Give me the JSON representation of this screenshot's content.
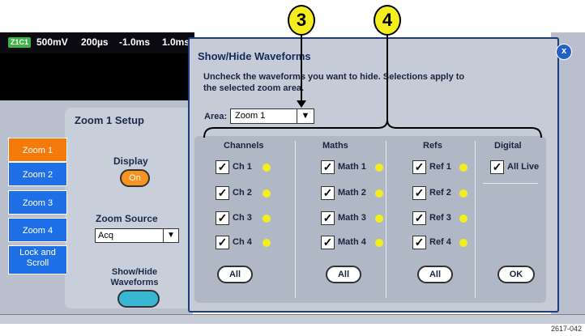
{
  "topbar": {
    "channel_badge": "Z1C1",
    "volts": "500mV",
    "time": "200µs",
    "offset": "-1.0ms",
    "position": "1.0ms"
  },
  "zoom_setup": {
    "title": "Zoom 1 Setup",
    "tabs": [
      {
        "label": "Zoom 1",
        "active": true
      },
      {
        "label": "Zoom 2",
        "active": false
      },
      {
        "label": "Zoom 3",
        "active": false
      },
      {
        "label": "Zoom 4",
        "active": false
      },
      {
        "label_line1": "Lock and",
        "label_line2": "Scroll",
        "active": false
      }
    ],
    "display_label": "Display",
    "display_value": "On",
    "zoom_source_label": "Zoom Source",
    "zoom_source_value": "Acq",
    "show_hide_line1": "Show/Hide",
    "show_hide_line2": "Waveforms"
  },
  "dialog": {
    "title": "Show/Hide Waveforms",
    "close_label": "x",
    "instruction_line1": "Uncheck the waveforms you want to hide. Selections apply to",
    "instruction_line2": "the selected zoom area.",
    "area_label": "Area:",
    "area_value": "Zoom 1",
    "groups": {
      "channels": {
        "heading": "Channels",
        "items": [
          "Ch 1",
          "Ch 2",
          "Ch 3",
          "Ch 4"
        ],
        "all_label": "All"
      },
      "maths": {
        "heading": "Maths",
        "items": [
          "Math 1",
          "Math 2",
          "Math 3",
          "Math 4"
        ],
        "all_label": "All"
      },
      "refs": {
        "heading": "Refs",
        "items": [
          "Ref 1",
          "Ref 2",
          "Ref 3",
          "Ref 4"
        ],
        "all_label": "All"
      },
      "digital": {
        "heading": "Digital",
        "items": [
          "All Live"
        ]
      }
    },
    "check_glyph": "✓",
    "ok_label": "OK"
  },
  "callouts": {
    "c3": "3",
    "c4": "4"
  },
  "figure_code": "2617-042",
  "colors": {
    "accent_blue": "#1f6fe6",
    "active_orange": "#f47a0c",
    "indicator_yellow": "#f4ee1e",
    "dialog_border": "#1d3d7a"
  },
  "icons": {
    "dropdown": "triangle-down",
    "close": "x-circle",
    "checkbox": "check-mark"
  }
}
